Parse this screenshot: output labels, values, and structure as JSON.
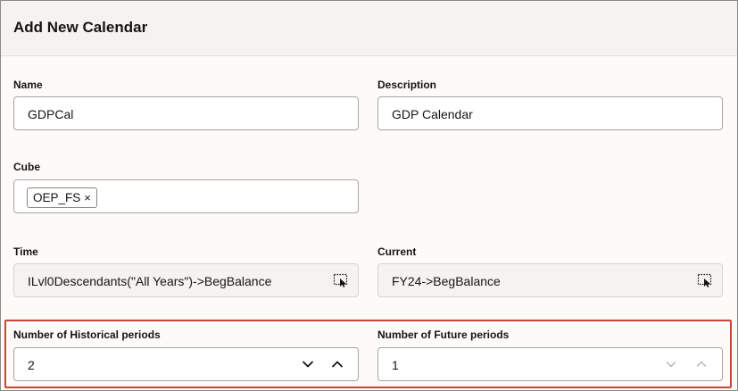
{
  "dialog": {
    "title": "Add New Calendar"
  },
  "fields": {
    "name": {
      "label": "Name",
      "value": "GDPCal"
    },
    "description": {
      "label": "Description",
      "value": "GDP Calendar"
    },
    "cube": {
      "label": "Cube",
      "chip": "OEP_FS",
      "chip_remove": "×"
    },
    "time": {
      "label": "Time",
      "value": "ILvl0Descendants(\"All Years\")->BegBalance",
      "icon": "member-selector-icon"
    },
    "current": {
      "label": "Current",
      "value": "FY24->BegBalance",
      "icon": "member-selector-icon"
    },
    "historical": {
      "label": "Number of Historical periods",
      "value": "2"
    },
    "future": {
      "label": "Number of Future periods",
      "value": "1"
    }
  },
  "colors": {
    "highlight": "#c74634",
    "text": "#161513",
    "disabled_icon": "#b5b2af"
  }
}
